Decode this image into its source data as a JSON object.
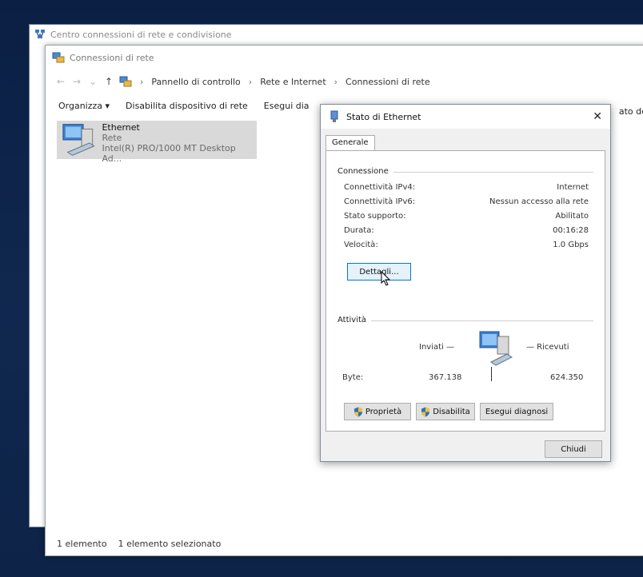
{
  "back_window": {
    "title": "Centro connessioni di rete e condivisione"
  },
  "main_window": {
    "title": "Connessioni di rete",
    "breadcrumbs": [
      "Pannello di controllo",
      "Rete e Internet",
      "Connessioni di rete"
    ],
    "commands": [
      "Organizza ▾",
      "Disabilita dispositivo di rete",
      "Esegui dia"
    ],
    "command_partial_right": "ato dell",
    "items": [
      {
        "name": "Ethernet",
        "status": "Rete",
        "adapter": "Intel(R) PRO/1000 MT Desktop Ad..."
      }
    ],
    "statusbar": {
      "count": "1 elemento",
      "selected": "1 elemento selezionato"
    }
  },
  "dialog": {
    "title": "Stato di Ethernet",
    "close_label": "✕",
    "tab": "Generale",
    "connection": {
      "label": "Connessione",
      "rows": [
        {
          "k": "Connettività IPv4:",
          "v": "Internet"
        },
        {
          "k": "Connettività IPv6:",
          "v": "Nessun accesso alla rete"
        },
        {
          "k": "Stato supporto:",
          "v": "Abilitato"
        },
        {
          "k": "Durata:",
          "v": "00:16:28"
        },
        {
          "k": "Velocità:",
          "v": "1.0 Gbps"
        }
      ],
      "details_button": "Dettagli..."
    },
    "activity": {
      "label": "Attività",
      "sent": "Inviati —",
      "received": "— Ricevuti",
      "bytes_label": "Byte:",
      "bytes_sent": "367.138",
      "bytes_received": "624.350"
    },
    "buttons": {
      "properties": "Proprietà",
      "disable": "Disabilita",
      "diagnose": "Esegui diagnosi"
    },
    "close_button": "Chiudi"
  },
  "icons": {
    "network_center": "network-center-icon",
    "network_connections": "network-connections-icon",
    "ethernet_adapter": "ethernet-adapter-icon",
    "status_dialog": "network-status-icon",
    "shield": "uac-shield-icon"
  }
}
